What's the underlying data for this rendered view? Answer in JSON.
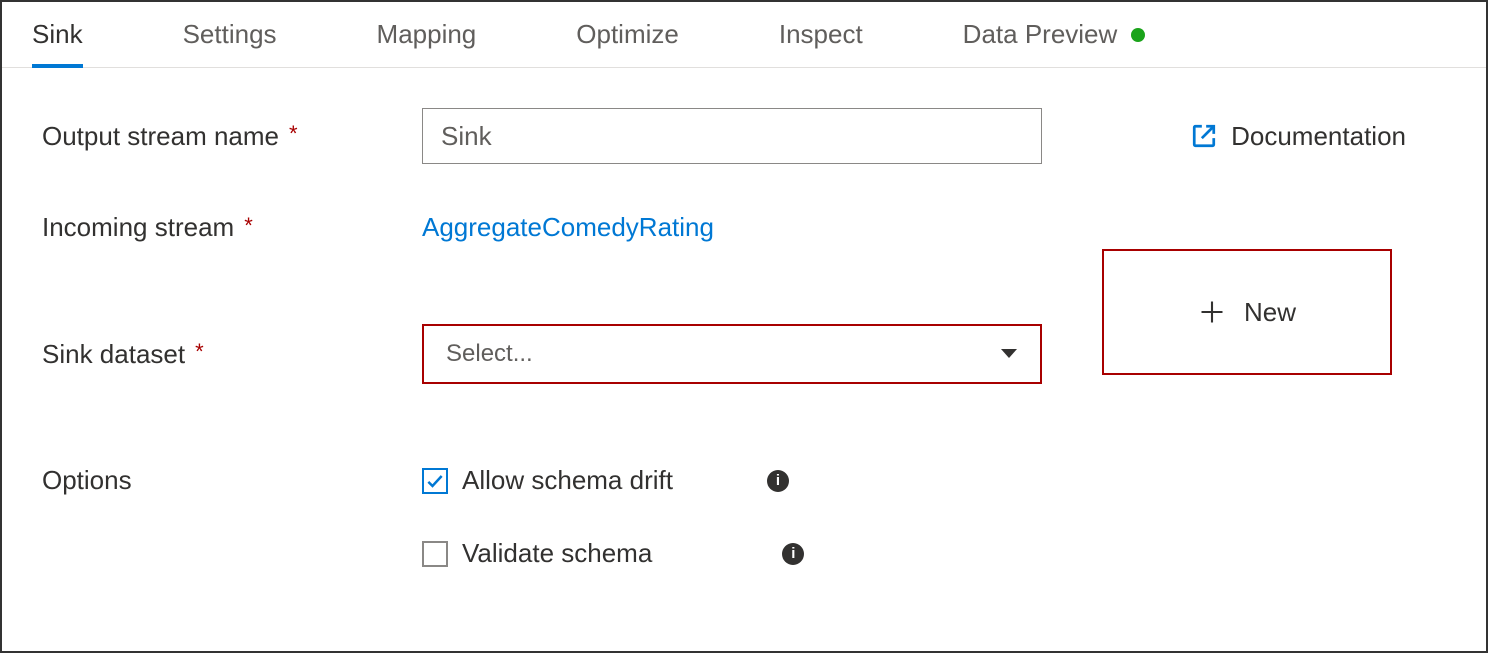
{
  "tabs": {
    "sink": "Sink",
    "settings": "Settings",
    "mapping": "Mapping",
    "optimize": "Optimize",
    "inspect": "Inspect",
    "dataPreview": "Data Preview"
  },
  "labels": {
    "outputStreamName": "Output stream name",
    "incomingStream": "Incoming stream",
    "sinkDataset": "Sink dataset",
    "options": "Options",
    "documentation": "Documentation"
  },
  "fields": {
    "outputStreamValue": "Sink",
    "incomingStreamValue": "AggregateComedyRating",
    "sinkDatasetPlaceholder": "Select...",
    "newButton": "New"
  },
  "options": {
    "allowSchemaDrift": "Allow schema drift",
    "validateSchema": "Validate schema"
  },
  "requiredMark": "*"
}
